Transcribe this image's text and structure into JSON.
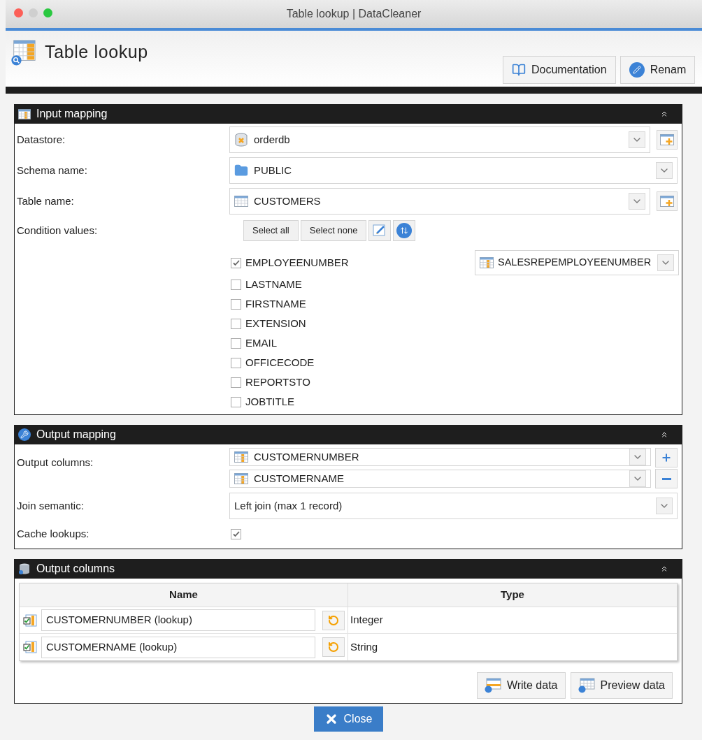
{
  "window": {
    "title": "Table lookup | DataCleaner"
  },
  "header": {
    "title": "Table lookup",
    "buttons": [
      {
        "label": "Documentation",
        "kind": "docs"
      },
      {
        "label": "Renam",
        "kind": "rename"
      }
    ]
  },
  "input_mapping": {
    "title": "Input mapping",
    "expanded": true,
    "rows": [
      {
        "label": "Datastore:",
        "value": "orderdb",
        "kind": "datastore",
        "add_button": true
      },
      {
        "label": "Schema name:",
        "value": "PUBLIC",
        "kind": "schema",
        "add_button": false
      },
      {
        "label": "Table name:",
        "value": "CUSTOMERS",
        "kind": "table",
        "add_button": true
      }
    ],
    "condition": {
      "label": "Condition values:",
      "buttons": [
        "Select all",
        "Select none"
      ],
      "columns": [
        {
          "name": "EMPLOYEENUMBER",
          "checked": true,
          "mapped_to": "SALESREPEMPLOYEENUMBER"
        },
        {
          "name": "LASTNAME",
          "checked": false
        },
        {
          "name": "FIRSTNAME",
          "checked": false
        },
        {
          "name": "EXTENSION",
          "checked": false
        },
        {
          "name": "EMAIL",
          "checked": false
        },
        {
          "name": "OFFICECODE",
          "checked": false
        },
        {
          "name": "REPORTSTO",
          "checked": false
        },
        {
          "name": "JOBTITLE",
          "checked": false
        }
      ]
    }
  },
  "output_mapping": {
    "title": "Output mapping",
    "expanded": true,
    "output_columns": {
      "label": "Output columns:",
      "values": [
        "CUSTOMERNUMBER",
        "CUSTOMERNAME"
      ]
    },
    "join_semantic": {
      "label": "Join semantic:",
      "value": "Left join (max 1 record)"
    },
    "cache_lookups": {
      "label": "Cache lookups:",
      "checked": true
    }
  },
  "output_columns": {
    "title": "Output columns",
    "expanded": true,
    "columns": [
      "Name",
      "Type"
    ],
    "rows": [
      {
        "name": "CUSTOMERNUMBER (lookup)",
        "type": "Integer"
      },
      {
        "name": "CUSTOMERNAME (lookup)",
        "type": "String"
      }
    ],
    "buttons": [
      {
        "label": "Write data",
        "kind": "write"
      },
      {
        "label": "Preview data",
        "kind": "preview"
      }
    ]
  },
  "close_button": "Close"
}
